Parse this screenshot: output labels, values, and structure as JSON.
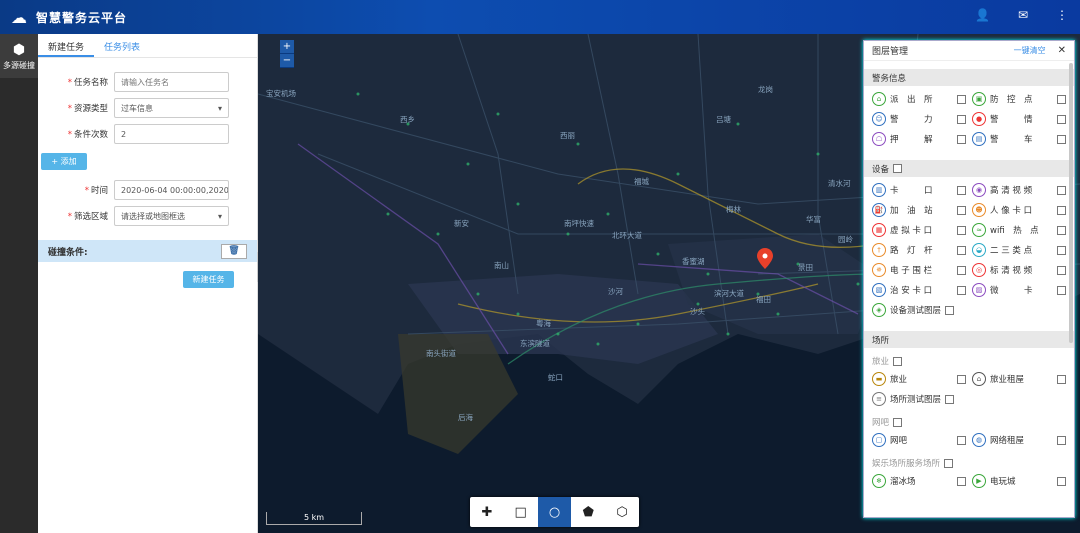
{
  "app": {
    "title": "智慧警务云平台"
  },
  "header": {
    "icons": [
      "user-icon",
      "message-icon",
      "more-icon"
    ]
  },
  "rail": {
    "item_label": "多源碰撞"
  },
  "tabs": [
    {
      "label": "新建任务"
    },
    {
      "label": "任务列表"
    }
  ],
  "form": {
    "task_name": {
      "label": "任务名称",
      "placeholder": "请输入任务名"
    },
    "resource_type": {
      "label": "资源类型",
      "value": "过车信息"
    },
    "condition_count": {
      "label": "条件次数",
      "value": "2"
    },
    "add_label": "+ 添加",
    "time": {
      "label": "时间",
      "value": "2020-06-04 00:00:00,2020"
    },
    "area": {
      "label": "筛选区域",
      "value": "请选择或地图框选"
    },
    "conditions_label": "碰撞条件:",
    "submit_label": "新建任务"
  },
  "map": {
    "scale_label": "5 km",
    "places": [
      "宝安机场",
      "西乡",
      "新安",
      "南山",
      "沙河",
      "粤海",
      "南头街道",
      "蛇口",
      "后海",
      "东滨隧道",
      "西丽",
      "梅林",
      "福田",
      "华富",
      "园岭",
      "景田",
      "香蜜湖",
      "沙头",
      "滨河大道",
      "北环大道",
      "南坪快速",
      "清水河",
      "布吉",
      "龙岗",
      "吕塘",
      "福城"
    ]
  },
  "layers": {
    "title": "图层管理",
    "clear_label": "一键清空",
    "sections": [
      {
        "title": "警务信息",
        "items": [
          {
            "label": "派　出　所",
            "icon": "police-station-icon"
          },
          {
            "label": "防　控　点",
            "icon": "control-point-icon"
          },
          {
            "label": "警　　　力",
            "icon": "police-force-icon"
          },
          {
            "label": "警　　　情",
            "icon": "alert-icon"
          },
          {
            "label": "押　　　解",
            "icon": "escort-icon"
          },
          {
            "label": "警　　　车",
            "icon": "police-car-icon"
          }
        ]
      },
      {
        "title": "设备",
        "items": [
          {
            "label": "卡　　　口",
            "icon": "checkpoint-icon"
          },
          {
            "label": "高 清 视 频",
            "icon": "hd-video-icon"
          },
          {
            "label": "加　油　站",
            "icon": "gas-station-icon"
          },
          {
            "label": "人 像 卡 口",
            "icon": "face-checkpoint-icon"
          },
          {
            "label": "虚 拟 卡 口",
            "icon": "virtual-checkpoint-icon"
          },
          {
            "label": "wifi　热　点",
            "icon": "wifi-icon"
          },
          {
            "label": "路　灯　杆",
            "icon": "lamp-post-icon"
          },
          {
            "label": "二 三 类 点",
            "icon": "category-point-icon"
          },
          {
            "label": "电 子 围 栏",
            "icon": "e-fence-icon"
          },
          {
            "label": "标 清 视 频",
            "icon": "sd-video-icon"
          },
          {
            "label": "治 安 卡 口",
            "icon": "security-checkpoint-icon"
          },
          {
            "label": "微　　　卡",
            "icon": "micro-checkpoint-icon"
          },
          {
            "label": "设备测试图层",
            "icon": "device-test-icon"
          }
        ]
      },
      {
        "title": "场所",
        "subgroups": [
          {
            "title": "旅业",
            "items": [
              {
                "label": "旅业",
                "icon": "hotel-icon"
              },
              {
                "label": "旅业租屋",
                "icon": "rental-icon"
              },
              {
                "label": "场所测试图层",
                "icon": "venue-test-icon"
              }
            ]
          },
          {
            "title": "网吧",
            "items": [
              {
                "label": "网吧",
                "icon": "netcafe-icon"
              },
              {
                "label": "网络租屋",
                "icon": "net-rental-icon"
              }
            ]
          },
          {
            "title": "娱乐场所服务场所",
            "items": [
              {
                "label": "溜冰场",
                "icon": "skating-icon"
              },
              {
                "label": "电玩城",
                "icon": "arcade-icon"
              }
            ]
          }
        ]
      }
    ]
  }
}
